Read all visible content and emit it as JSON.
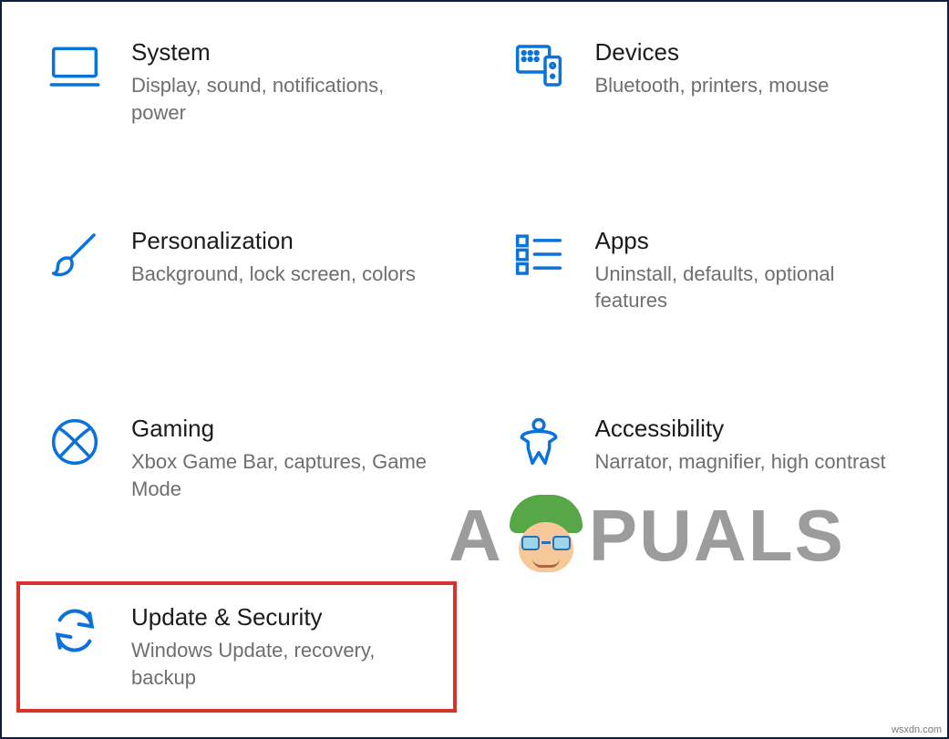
{
  "categories": [
    {
      "id": "system",
      "icon": "monitor-icon",
      "title": "System",
      "desc": "Display, sound, notifications, power",
      "highlighted": false
    },
    {
      "id": "devices",
      "icon": "devices-icon",
      "title": "Devices",
      "desc": "Bluetooth, printers, mouse",
      "highlighted": false
    },
    {
      "id": "personalization",
      "icon": "brush-icon",
      "title": "Personalization",
      "desc": "Background, lock screen, colors",
      "highlighted": false
    },
    {
      "id": "apps",
      "icon": "apps-list-icon",
      "title": "Apps",
      "desc": "Uninstall, defaults, optional features",
      "highlighted": false
    },
    {
      "id": "gaming",
      "icon": "xbox-icon",
      "title": "Gaming",
      "desc": "Xbox Game Bar, captures, Game Mode",
      "highlighted": false
    },
    {
      "id": "accessibility",
      "icon": "person-icon",
      "title": "Accessibility",
      "desc": "Narrator, magnifier, high contrast",
      "highlighted": false
    },
    {
      "id": "update-security",
      "icon": "sync-icon",
      "title": "Update & Security",
      "desc": "Windows Update, recovery, backup",
      "highlighted": true
    }
  ],
  "watermark": {
    "left": "A",
    "right": "PUALS"
  },
  "attribution": "wsxdn.com",
  "accent": "#0a72d8"
}
